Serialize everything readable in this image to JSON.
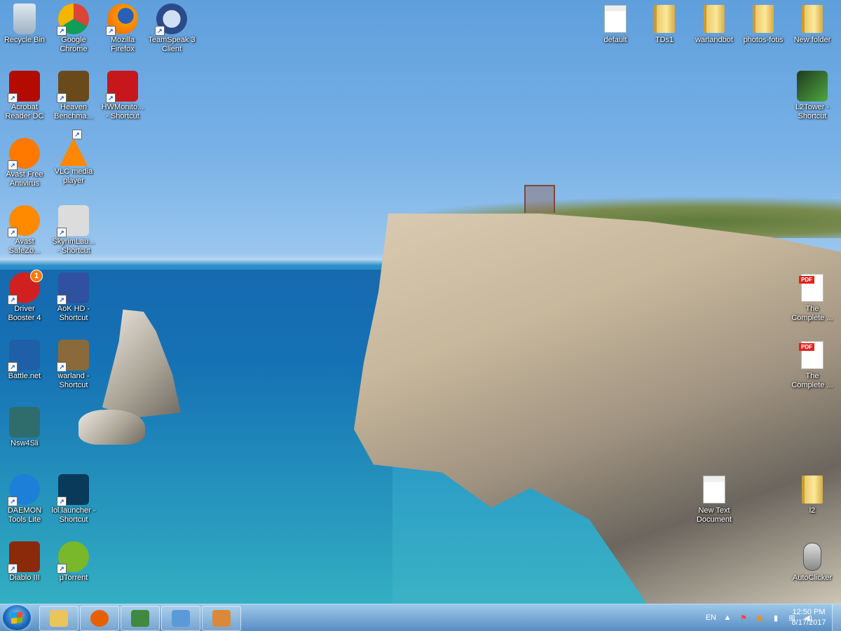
{
  "desktop_icons_left": [
    {
      "label": "Recycle Bin",
      "icon": "recycle-bin-icon",
      "color": "#b8c8d8",
      "shortcut": false
    },
    {
      "label": "Google\nChrome",
      "icon": "chrome-icon",
      "color": "#dd4b39",
      "shortcut": true
    },
    {
      "label": "Mozilla\nFirefox",
      "icon": "firefox-icon",
      "color": "#e66000",
      "shortcut": true
    },
    {
      "label": "TeamSpeak 3\nClient",
      "icon": "teamspeak-icon",
      "color": "#2a4a8a",
      "shortcut": true
    },
    {
      "label": "Acrobat\nReader DC",
      "icon": "acrobat-icon",
      "color": "#b30b00",
      "shortcut": true
    },
    {
      "label": "Heaven\nBenchma...",
      "icon": "heaven-benchmark-icon",
      "color": "#6a4a1a",
      "shortcut": true
    },
    {
      "label": "HWMonito...\n- Shortcut",
      "icon": "hwmonitor-icon",
      "color": "#c8161d",
      "shortcut": true
    },
    {
      "label": "Avast Free\nAntivirus",
      "icon": "avast-icon",
      "color": "#ff7800",
      "shortcut": true
    },
    {
      "label": "VLC media\nplayer",
      "icon": "vlc-icon",
      "color": "#ff8800",
      "shortcut": true
    },
    {
      "label": "Avast\nSafeZo...",
      "icon": "avast-safezone-icon",
      "color": "#ff8a00",
      "shortcut": true
    },
    {
      "label": "SkyrimLau...\n- Shortcut",
      "icon": "skyrim-icon",
      "color": "#dcdcdc",
      "shortcut": true
    },
    {
      "label": "Driver\nBooster 4",
      "icon": "driver-booster-icon",
      "color": "#d02020",
      "shortcut": true
    },
    {
      "label": "AoK HD -\nShortcut",
      "icon": "aok-hd-icon",
      "color": "#3050a0",
      "shortcut": true
    },
    {
      "label": "Battle.net",
      "icon": "battlenet-icon",
      "color": "#1f5fa8",
      "shortcut": true
    },
    {
      "label": "warland -\nShortcut",
      "icon": "lineage-icon",
      "color": "#8a6a3a",
      "shortcut": true
    },
    {
      "label": "Nsw4Sli",
      "icon": "nsw4sli-icon",
      "color": "#2f6d6d",
      "shortcut": false
    },
    {
      "label": "DAEMON\nTools Lite",
      "icon": "daemon-tools-icon",
      "color": "#1e7fd8",
      "shortcut": true
    },
    {
      "label": "lol.launcher -\nShortcut",
      "icon": "league-of-legends-icon",
      "color": "#0a3a5a",
      "shortcut": true
    },
    {
      "label": "Diablo III",
      "icon": "diablo-icon",
      "color": "#8a2a0a",
      "shortcut": true
    },
    {
      "label": "µTorrent",
      "icon": "utorrent-icon",
      "color": "#78b82a",
      "shortcut": true
    }
  ],
  "desktop_icons_right": [
    {
      "label": "default",
      "icon": "settings-file-icon",
      "kind": "doc"
    },
    {
      "label": "TDs1",
      "icon": "folder-icon",
      "kind": "folder"
    },
    {
      "label": "warlandbot",
      "icon": "folder-icon",
      "kind": "folder"
    },
    {
      "label": "photos-fotis",
      "icon": "folder-icon",
      "kind": "folder"
    },
    {
      "label": "New folder",
      "icon": "folder-icon",
      "kind": "folder"
    },
    {
      "label": "L2Tower -\nShortcut",
      "icon": "l2tower-icon",
      "kind": "app"
    },
    {
      "label": "The\nComplete ...",
      "icon": "pdf-icon",
      "kind": "pdf"
    },
    {
      "label": "The\nComplete ...",
      "icon": "pdf-icon",
      "kind": "pdf"
    },
    {
      "label": "New Text\nDocument",
      "icon": "text-document-icon",
      "kind": "doc"
    },
    {
      "label": "l2",
      "icon": "folder-icon",
      "kind": "folder"
    },
    {
      "label": "AutoClicker",
      "icon": "mouse-icon",
      "kind": "app"
    }
  ],
  "taskbar": {
    "start": "start-button",
    "pinned": [
      {
        "name": "explorer",
        "icon": "folder-icon",
        "color": "#e9c55c"
      },
      {
        "name": "firefox",
        "icon": "firefox-icon",
        "color": "#e66000"
      },
      {
        "name": "app-monitor",
        "icon": "monitor-icon",
        "color": "#3f8a3f"
      },
      {
        "name": "app-network",
        "icon": "network-icon",
        "color": "#5a9ad8"
      },
      {
        "name": "paint",
        "icon": "paint-icon",
        "color": "#d88a3a"
      }
    ],
    "language": "EN",
    "clock_time": "12:50 PM",
    "clock_date": "8/17/2017"
  },
  "badges": {
    "driver_booster": "1",
    "pdf": "PDF"
  }
}
